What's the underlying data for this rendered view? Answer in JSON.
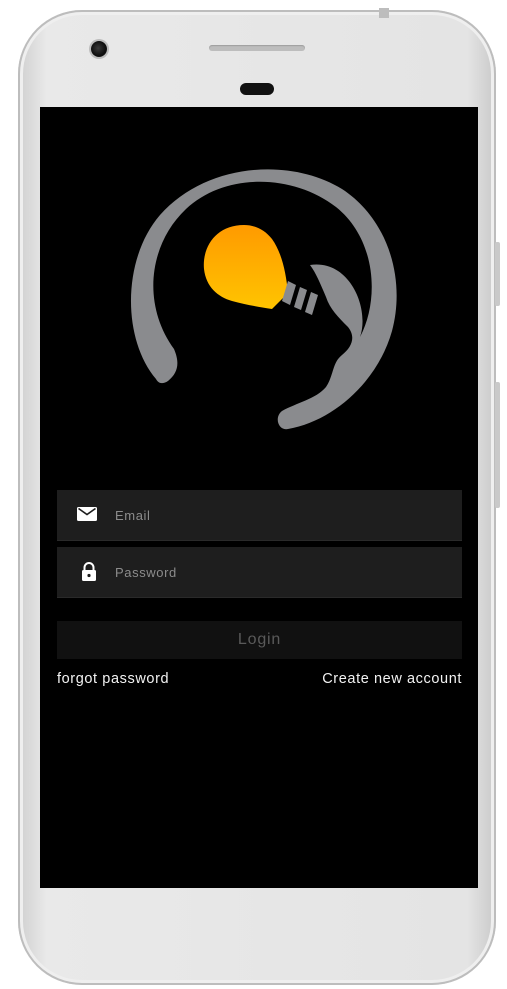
{
  "form": {
    "email": {
      "value": "",
      "placeholder": "Email",
      "icon": "mail-icon"
    },
    "password": {
      "value": "",
      "placeholder": "Password",
      "icon": "lock-icon"
    },
    "login_label": "Login",
    "forgot_label": "forgot password",
    "create_label": "Create new account"
  },
  "logo": {
    "icon": "lightbulb-head-logo",
    "ring_color": "#8a8b8e",
    "bulb_color_top": "#ff9a00",
    "bulb_color_bottom": "#ffc400"
  },
  "theme": {
    "screen_bg": "#000000",
    "field_bg": "#1e1e1e",
    "button_bg": "#111111",
    "button_text": "#5a5a5a",
    "link_text": "#f2f2f2"
  }
}
